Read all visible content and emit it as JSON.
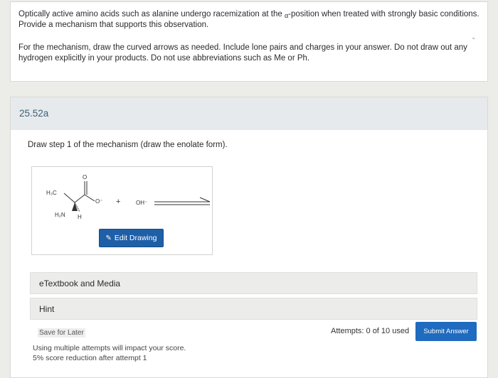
{
  "question": {
    "line1_pre": "Optically active amino acids such as alanine undergo racemization at the ",
    "alpha": "α",
    "line1_post": "-position when treated with strongly basic conditions.",
    "line2": "Provide a mechanism that supports this observation.",
    "line3": "For the mechanism, draw the curved arrows as needed. Include lone pairs and charges in your answer. Do not draw out any",
    "line4": "hydrogen explicitly in your products. Do not use abbreviations such as Me or Ph."
  },
  "part": {
    "label": "25.52a",
    "step_text": "Draw step 1 of the mechanism (draw the enolate form).",
    "drawing": {
      "labels": {
        "h3c": "H₃C",
        "o_top": "O",
        "o_minus": "O⁻",
        "h2n": "H₂N",
        "h": "H",
        "plus": "+",
        "oh": "OH⁻"
      },
      "edit_button": "Edit Drawing",
      "edit_icon": "pencil-icon"
    },
    "etextbook_label": "eTextbook and Media",
    "hint_label": "Hint",
    "save_later": "Save for Later",
    "attempts": "Attempts: 0 of 10 used",
    "submit": "Submit Answer",
    "note1": "Using multiple attempts will impact your score.",
    "note2": "5% score reduction after attempt 1"
  },
  "colors": {
    "header_bg": "#e6eaec",
    "part_label": "#3d5f78",
    "button_blue": "#1f5fa8"
  }
}
